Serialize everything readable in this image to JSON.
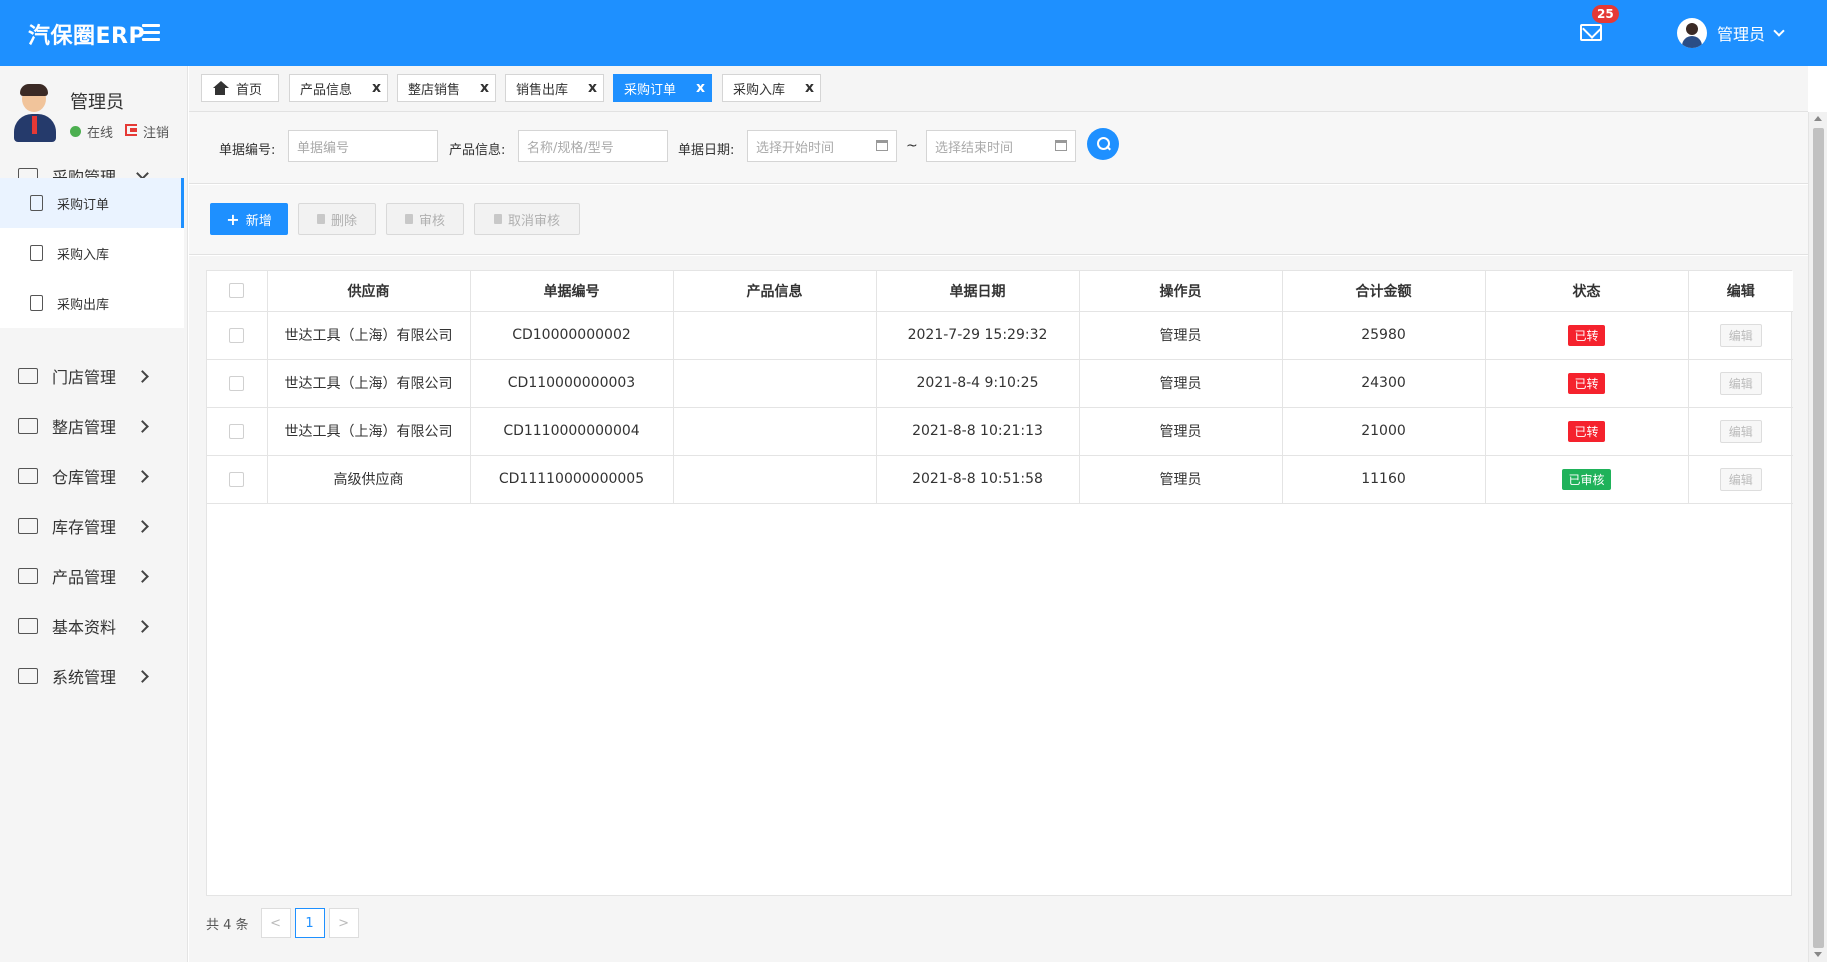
{
  "app": {
    "title": "汽保圈ERP",
    "accent_color": "#1e90ff",
    "notifications": {
      "icon": "mail-icon",
      "count": "25"
    },
    "user": {
      "name": "管理员"
    }
  },
  "sidebar": {
    "profile": {
      "name": "管理员",
      "status": "在线",
      "logout": "注销"
    },
    "menu": [
      {
        "label": "采购管理",
        "icon": "monitor-icon",
        "expanded": true,
        "children": [
          {
            "label": "采购订单",
            "active": true
          },
          {
            "label": "采购入库"
          },
          {
            "label": "采购出库"
          }
        ]
      },
      {
        "label": "门店管理",
        "icon": "briefcase-icon"
      },
      {
        "label": "整店管理",
        "icon": "map-icon"
      },
      {
        "label": "仓库管理",
        "icon": "layers-icon"
      },
      {
        "label": "库存管理",
        "icon": "gift-icon"
      },
      {
        "label": "产品管理",
        "icon": "dropbox-icon"
      },
      {
        "label": "基本资料",
        "icon": "grid-icon"
      },
      {
        "label": "系统管理",
        "icon": "gear-icon"
      }
    ]
  },
  "tabs": [
    {
      "label": "首页",
      "icon": "home-icon",
      "closable": false
    },
    {
      "label": "产品信息",
      "closable": true
    },
    {
      "label": "整店销售",
      "closable": true
    },
    {
      "label": "销售出库",
      "closable": true
    },
    {
      "label": "采购订单",
      "closable": true,
      "active": true
    },
    {
      "label": "采购入库",
      "closable": true
    }
  ],
  "tab_close": "x",
  "filter": {
    "order_no_label": "单据编号:",
    "order_no_placeholder": "单据编号",
    "product_label": "产品信息:",
    "product_placeholder": "名称/规格/型号",
    "date_label": "单据日期:",
    "start_placeholder": "选择开始时间",
    "range_sep": "~",
    "end_placeholder": "选择结束时间"
  },
  "actions": {
    "add": "新增",
    "delete": "删除",
    "audit": "审核",
    "cancel_audit": "取消审核"
  },
  "table": {
    "columns": [
      "供应商",
      "单据编号",
      "产品信息",
      "单据日期",
      "操作员",
      "合计金额",
      "状态",
      "编辑"
    ],
    "rows": [
      {
        "supplier": "世达工具（上海）有限公司",
        "order_no": "CD10000000002",
        "product": "",
        "date": "2021-7-29 15:29:32",
        "operator": "管理员",
        "amount": "25980",
        "status": "已转",
        "status_color": "#f5222d",
        "edit": "编辑"
      },
      {
        "supplier": "世达工具（上海）有限公司",
        "order_no": "CD110000000003",
        "product": "",
        "date": "2021-8-4 9:10:25",
        "operator": "管理员",
        "amount": "24300",
        "status": "已转",
        "status_color": "#f5222d",
        "edit": "编辑"
      },
      {
        "supplier": "世达工具（上海）有限公司",
        "order_no": "CD1110000000004",
        "product": "",
        "date": "2021-8-8 10:21:13",
        "operator": "管理员",
        "amount": "21000",
        "status": "已转",
        "status_color": "#f5222d",
        "edit": "编辑"
      },
      {
        "supplier": "高级供应商",
        "order_no": "CD11110000000005",
        "product": "",
        "date": "2021-8-8 10:51:58",
        "operator": "管理员",
        "amount": "11160",
        "status": "已审核",
        "status_color": "#1fb25a",
        "edit": "编辑"
      }
    ]
  },
  "pagination": {
    "total": "共 4 条",
    "prev": "<",
    "current": "1",
    "next": ">"
  }
}
